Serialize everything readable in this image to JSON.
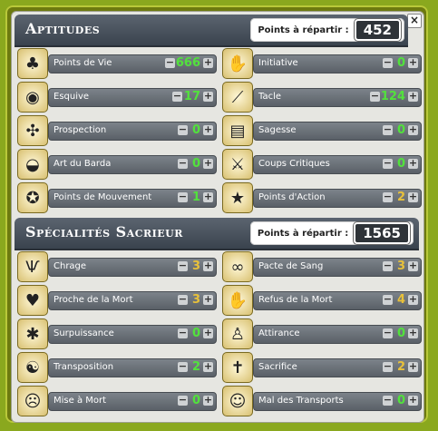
{
  "aptitudes": {
    "title": "Aptitudes",
    "points_label": "Points à répartir :",
    "points_value": "452",
    "items": [
      {
        "label": "Points de Vie",
        "value": "666",
        "icon": "life-icon",
        "color": "green"
      },
      {
        "label": "Initiative",
        "value": "0",
        "icon": "initiative-icon",
        "color": "green"
      },
      {
        "label": "Esquive",
        "value": "17",
        "icon": "dodge-icon",
        "color": "green"
      },
      {
        "label": "Tacle",
        "value": "124",
        "icon": "tackle-icon",
        "color": "green"
      },
      {
        "label": "Prospection",
        "value": "0",
        "icon": "prospecting-icon",
        "color": "green"
      },
      {
        "label": "Sagesse",
        "value": "0",
        "icon": "wisdom-icon",
        "color": "green"
      },
      {
        "label": "Art du Barda",
        "value": "0",
        "icon": "pack-icon",
        "color": "green"
      },
      {
        "label": "Coups Critiques",
        "value": "0",
        "icon": "critical-icon",
        "color": "green"
      },
      {
        "label": "Points de Mouvement",
        "value": "1",
        "icon": "movement-icon",
        "color": "green"
      },
      {
        "label": "Points d'Action",
        "value": "2",
        "icon": "action-star-icon",
        "color": "yellow"
      }
    ]
  },
  "specialites": {
    "title": "Spécialités Sacrieur",
    "points_label": "Points à répartir :",
    "points_value": "1565",
    "items": [
      {
        "label": "Chrage",
        "value": "3",
        "icon": "charge-icon",
        "color": "yellow"
      },
      {
        "label": "Pacte de Sang",
        "value": "3",
        "icon": "blood-pact-icon",
        "color": "yellow"
      },
      {
        "label": "Proche de la Mort",
        "value": "3",
        "icon": "near-death-icon",
        "color": "yellow"
      },
      {
        "label": "Refus de la Mort",
        "value": "4",
        "icon": "refuse-death-icon",
        "color": "yellow"
      },
      {
        "label": "Surpuissance",
        "value": "0",
        "icon": "overpower-icon",
        "color": "green"
      },
      {
        "label": "Attirance",
        "value": "0",
        "icon": "attraction-icon",
        "color": "green"
      },
      {
        "label": "Transposition",
        "value": "2",
        "icon": "transposition-icon",
        "color": "green"
      },
      {
        "label": "Sacrifice",
        "value": "2",
        "icon": "sacrifice-icon",
        "color": "yellow"
      },
      {
        "label": "Mise à Mort",
        "value": "0",
        "icon": "execute-icon",
        "color": "green"
      },
      {
        "label": "Mal des Transports",
        "value": "0",
        "icon": "transport-icon",
        "color": "green"
      }
    ]
  },
  "close_label": "×",
  "minus_label": "−",
  "plus_label": "+"
}
